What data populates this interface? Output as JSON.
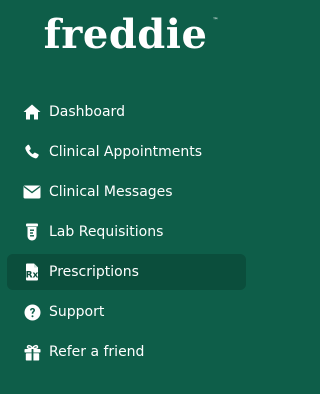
{
  "brand": {
    "name": "freddie",
    "trademark": "™"
  },
  "colors": {
    "background": "#0e5e49",
    "active_item_background": "#0b4e3c",
    "text": "#ffffff"
  },
  "nav": {
    "active_index": 4,
    "items": [
      {
        "label": "Dashboard",
        "icon": "home-icon"
      },
      {
        "label": "Clinical Appointments",
        "icon": "phone-icon"
      },
      {
        "label": "Clinical Messages",
        "icon": "envelope-icon"
      },
      {
        "label": "Lab Requisitions",
        "icon": "test-tube-icon"
      },
      {
        "label": "Prescriptions",
        "icon": "prescription-icon"
      },
      {
        "label": "Support",
        "icon": "question-circle-icon"
      },
      {
        "label": "Refer a friend",
        "icon": "gift-icon"
      }
    ]
  }
}
